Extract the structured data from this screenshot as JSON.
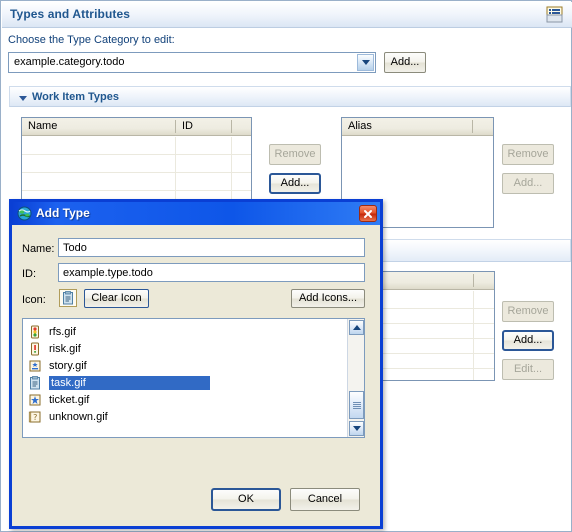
{
  "form": {
    "title": "Types and Attributes",
    "menu_icon": "form-menu-icon",
    "choose_label": "Choose the Type Category to edit:",
    "category_combo": {
      "value": "example.category.todo",
      "arrow_icon": "chevron-down-icon"
    },
    "add_category_label": "Add..."
  },
  "section_work_item_types": {
    "title": "Work Item Types",
    "twisty_icon": "triangle-down-icon",
    "types_table": {
      "columns": [
        "Name",
        "ID",
        ""
      ],
      "rows": []
    },
    "alias_table": {
      "columns": [
        "Alias",
        ""
      ],
      "rows": []
    },
    "types_buttons": {
      "remove": "Remove",
      "add": "Add..."
    },
    "alias_buttons": {
      "remove": "Remove",
      "add": "Add..."
    }
  },
  "section_attributes": {
    "title": "",
    "attrs_table": {
      "columns": [
        "",
        ""
      ],
      "rows": []
    },
    "buttons": {
      "remove": "Remove",
      "add": "Add...",
      "edit": "Edit..."
    }
  },
  "dialog": {
    "title": "Add Type",
    "title_icon": "globe-icon",
    "close_icon": "close-icon",
    "fields": {
      "name_label": "Name:",
      "name_value": "Todo",
      "id_label": "ID:",
      "id_value": "example.type.todo",
      "icon_label": "Icon:",
      "icon_preview": "clipboard-icon",
      "clear_icon_label": "Clear Icon",
      "add_icons_label": "Add Icons..."
    },
    "icon_list": {
      "items": [
        {
          "label": "rfs.gif",
          "icon": "traffic-light-icon",
          "selected": false
        },
        {
          "label": "risk.gif",
          "icon": "exclamation-icon",
          "selected": false
        },
        {
          "label": "story.gif",
          "icon": "star-note-icon",
          "selected": false
        },
        {
          "label": "task.gif",
          "icon": "clipboard-icon",
          "selected": true
        },
        {
          "label": "ticket.gif",
          "icon": "star-blue-icon",
          "selected": false
        },
        {
          "label": "unknown.gif",
          "icon": "question-note-icon",
          "selected": false
        }
      ],
      "scrollbar": {
        "up_icon": "scroll-up-icon",
        "down_icon": "scroll-down-icon",
        "thumb": "scroll-thumb"
      }
    },
    "buttons": {
      "ok": "OK",
      "cancel": "Cancel"
    }
  },
  "colors": {
    "section_title": "#20578f",
    "dialog_border": "#0a3fd4",
    "titlebar_start": "#0a3fd4",
    "titlebar_end": "#2f7cf5",
    "selection": "#316ac5",
    "table_header": "#eeece1",
    "dialog_face": "#ece9d8"
  }
}
